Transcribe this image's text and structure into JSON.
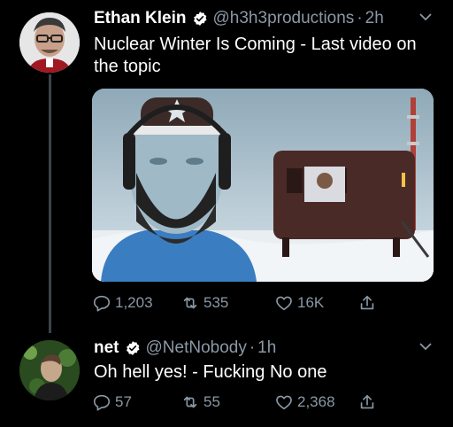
{
  "tweets": [
    {
      "display_name": "Ethan Klein",
      "handle": "@h3h3productions",
      "separator": "·",
      "time": "2h",
      "text": "Nuclear Winter Is Coming - Last video on the topic",
      "actions": {
        "replies": "1,203",
        "retweets": "535",
        "likes": "16K"
      }
    },
    {
      "display_name": "net",
      "handle": "@NetNobody",
      "separator": "·",
      "time": "1h",
      "text": "Oh hell yes! - Fucking No one",
      "actions": {
        "replies": "57",
        "retweets": "55",
        "likes": "2,368"
      }
    }
  ],
  "colors": {
    "background": "#000000",
    "secondary_text": "#8b98a5",
    "verified_badge": "#ffffff",
    "thread_line": "#3d4348"
  },
  "icons": [
    "verified-badge-icon",
    "chevron-down-icon",
    "reply-icon",
    "retweet-icon",
    "like-icon",
    "share-icon"
  ]
}
